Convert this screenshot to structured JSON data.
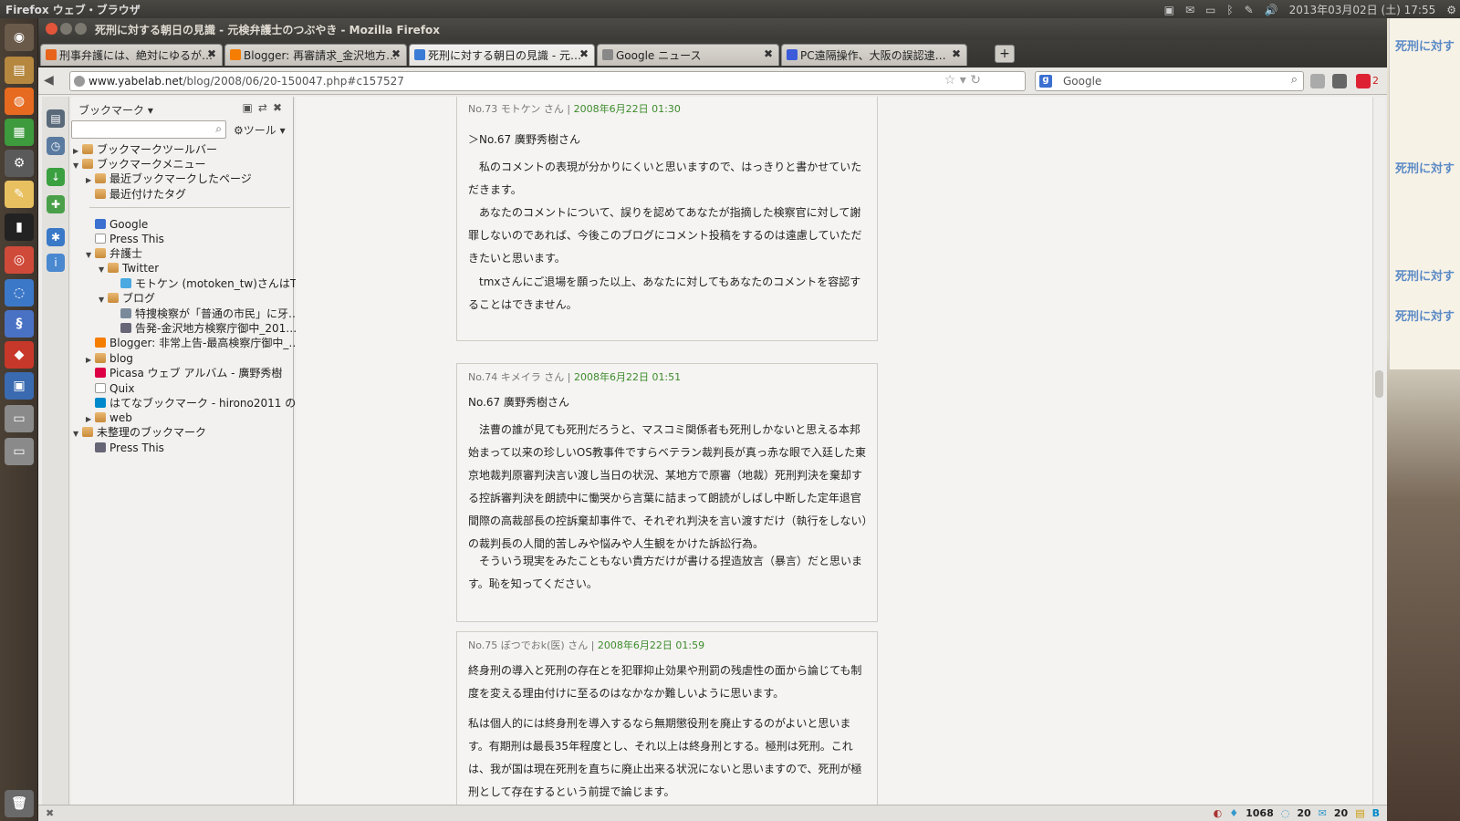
{
  "topbar": {
    "app_name": "Firefox ウェブ・ブラウザ",
    "datetime": "2013年03月02日 (土) 17:55"
  },
  "window": {
    "title": "死刑に対する朝日の見識 - 元検弁護士のつぶやき - Mozilla Firefox"
  },
  "tabs": [
    {
      "label": "刑事弁護には、絶対にゆるが…",
      "fav_color": "#e8641b"
    },
    {
      "label": "Blogger: 再審請求_金沢地方…",
      "fav_color": "#f57d00"
    },
    {
      "label": "死刑に対する朝日の見識 - 元…",
      "fav_color": "#3a7bd5"
    },
    {
      "label": "Google ニュース",
      "fav_color": "#888888"
    },
    {
      "label": "PC遠隔操作、大阪の誤認逮…",
      "fav_color": "#3b5bdb"
    }
  ],
  "newtab_label": "+",
  "navbar": {
    "url_domain": "www.yabelab.net",
    "url_path": "/blog/2008/06/20-150047.php#c157527",
    "search_engine": "Google",
    "badge": "2"
  },
  "sidebar": {
    "title": "ブックマーク",
    "tools_label": "ツール",
    "tree": [
      {
        "label": "ブックマークツールバー",
        "level": 0,
        "twisty": "▶",
        "icon": "folder"
      },
      {
        "label": "ブックマークメニュー",
        "level": 0,
        "twisty": "▼",
        "icon": "folder"
      },
      {
        "label": "最近ブックマークしたページ",
        "level": 1,
        "twisty": "▶",
        "icon": "folder"
      },
      {
        "label": "最近付けたタグ",
        "level": 1,
        "twisty": "",
        "icon": "folder"
      },
      {
        "label": "Google",
        "level": 1,
        "twisty": "",
        "icon": "google"
      },
      {
        "label": "Press This",
        "level": 1,
        "twisty": "",
        "icon": "page"
      },
      {
        "label": "弁護士",
        "level": 1,
        "twisty": "▼",
        "icon": "folder"
      },
      {
        "label": "Twitter",
        "level": 2,
        "twisty": "▼",
        "icon": "folder"
      },
      {
        "label": "モトケン (motoken_tw)さんはT…",
        "level": 3,
        "twisty": "",
        "icon": "twitter"
      },
      {
        "label": "ブログ",
        "level": 2,
        "twisty": "▼",
        "icon": "folder"
      },
      {
        "label": "特捜検察が「普通の市民」に牙…",
        "level": 3,
        "twisty": "",
        "icon": "wordpress"
      },
      {
        "label": "告発-金沢地方検察庁御中_201…",
        "level": 3,
        "twisty": "",
        "icon": "image"
      },
      {
        "label": "Blogger: 非常上告-最高検察庁御中_…",
        "level": 1,
        "twisty": "",
        "icon": "blogger"
      },
      {
        "label": "blog",
        "level": 1,
        "twisty": "▶",
        "icon": "folder"
      },
      {
        "label": "Picasa ウェブ アルバム - 廣野秀樹",
        "level": 1,
        "twisty": "",
        "icon": "picasa"
      },
      {
        "label": "Quix",
        "level": 1,
        "twisty": "",
        "icon": "page"
      },
      {
        "label": "はてなブックマーク - hirono2011 のブ…",
        "level": 1,
        "twisty": "",
        "icon": "hatena"
      },
      {
        "label": "web",
        "level": 1,
        "twisty": "▶",
        "icon": "folder"
      },
      {
        "label": "未整理のブックマーク",
        "level": 0,
        "twisty": "▼",
        "icon": "folder"
      },
      {
        "label": "Press This",
        "level": 1,
        "twisty": "",
        "icon": "image"
      }
    ]
  },
  "comments": [
    {
      "meta_prefix": "No.73 モトケン さん | ",
      "meta_date": "2008年6月22日 01:30",
      "paragraphs": [
        "＞No.67 廣野秀樹さん",
        "　私のコメントの表現が分かりにくいと思いますので、はっきりと書かせていただきます。",
        "　あなたのコメントについて、誤りを認めてあなたが指摘した検察官に対して謝罪しないのであれば、今後このブログにコメント投稿をするのは遠慮していただきたいと思います。",
        "　tmxさんにご退場を願った以上、あなたに対してもあなたのコメントを容認することはできません。"
      ]
    },
    {
      "meta_prefix": "No.74 キメイラ さん | ",
      "meta_date": "2008年6月22日 01:51",
      "paragraphs": [
        "No.67 廣野秀樹さん",
        "　法曹の誰が見ても死刑だろうと、マスコミ関係者も死刑しかないと思える本邦始まって以来の珍しいOS教事件ですらベテラン裁判長が真っ赤な眼で入廷した東京地裁判原審判決言い渡し当日の状況、某地方で原審（地裁）死刑判決を棄却する控訴審判決を朗読中に慟哭から言葉に詰まって朗読がしばし中断した定年退官間際の高裁部長の控訴棄却事件で、それぞれ判決を言い渡すだけ（執行をしない）の裁判長の人間的苦しみや悩みや人生観をかけた訴訟行為。",
        "　そういう現実をみたこともない貴方だけが書ける捏造放言（暴言）だと思います。恥を知ってください。"
      ]
    },
    {
      "meta_prefix": "No.75 ぼつでおk(医) さん | ",
      "meta_date": "2008年6月22日 01:59",
      "paragraphs": [
        "終身刑の導入と死刑の存在とを犯罪抑止効果や刑罰の残虐性の面から論じても制度を変える理由付けに至るのはなかなか難しいように思います。",
        "私は個人的には終身刑を導入するなら無期懲役刑を廃止するのがよいと思います。有期刑は最長35年程度とし、それ以上は終身刑とする。極刑は死刑。これは、我が国は現在死刑を直ちに廃止出来る状況にないと思いますので、死刑が極刑として存在するという前提で論じます。"
      ]
    }
  ],
  "desktop_notes": [
    "死刑に対す",
    "死刑に対す",
    "死刑に対す",
    "死刑に対す"
  ],
  "statusbar": {
    "count1": "1068",
    "count2": "20",
    "count3": "20"
  }
}
